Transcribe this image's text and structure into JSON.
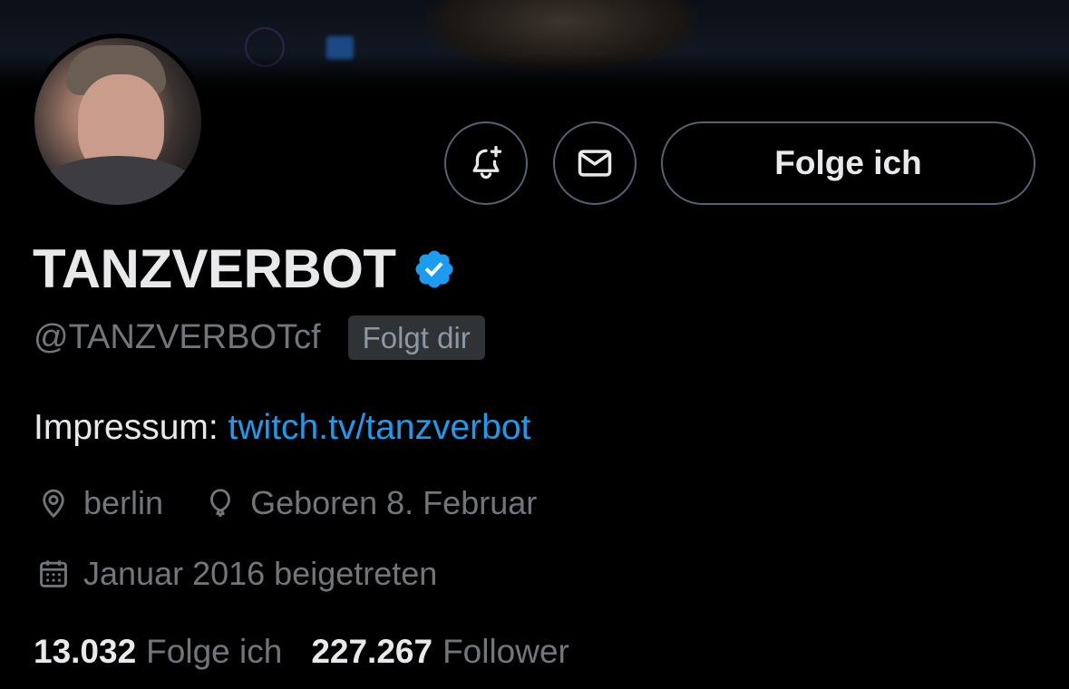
{
  "profile": {
    "display_name": "TANZVERBOT",
    "handle": "@TANZVERBOTcf",
    "follows_you_badge": "Folgt dir",
    "verified": true,
    "verified_color": "#1d9bf0"
  },
  "actions": {
    "notify_icon": "bell-plus-icon",
    "message_icon": "envelope-icon",
    "follow_label": "Folge ich"
  },
  "bio": {
    "prefix": "Impressum: ",
    "link_text": "twitch.tv/tanzverbot",
    "link_color": "#1d9bf0"
  },
  "meta": {
    "location": "berlin",
    "location_icon": "location-pin-icon",
    "birthday": "Geboren 8. Februar",
    "birthday_icon": "balloon-icon",
    "joined": "Januar 2016 beigetreten",
    "joined_icon": "calendar-icon"
  },
  "stats": {
    "following_count": "13.032",
    "following_label": "Folge ich",
    "followers_count": "227.267",
    "followers_label": "Follower"
  }
}
